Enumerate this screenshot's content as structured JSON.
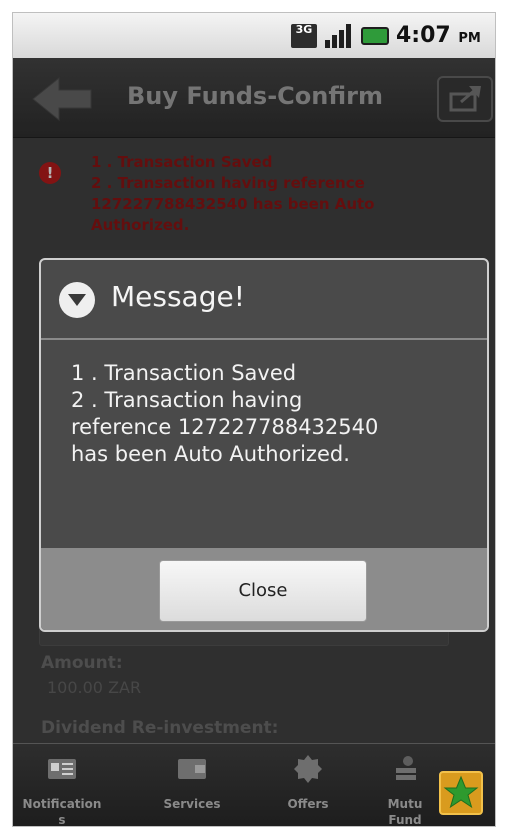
{
  "status_bar": {
    "network_badge": "3G",
    "time": "4:07",
    "ampm": "PM",
    "icons": [
      "3g-icon",
      "signal-icon",
      "battery-icon"
    ]
  },
  "header": {
    "title": "Buy Funds-Confirm",
    "back_icon": "back-arrow-icon",
    "share_icon": "share-icon"
  },
  "background": {
    "error_icon": "!",
    "error_lines": [
      "1 . Transaction Saved",
      "2 . Transaction having reference 127227788432540 has been Auto Authorized."
    ],
    "amount_label": "Amount:",
    "amount_value": "100.00 ZAR",
    "dividend_label": "Dividend Re-investment:"
  },
  "dialog": {
    "title": "Message!",
    "icon": "chevron-down-circle-icon",
    "line1": "1 . Transaction Saved",
    "line2": "2 . Transaction having\nreference 127227788432540\nhas been Auto Authorized.",
    "close_label": "Close"
  },
  "tabs": [
    {
      "label": "Notification\ns",
      "icon": "notification-card-icon"
    },
    {
      "label": "Services",
      "icon": "wallet-icon"
    },
    {
      "label": "Offers",
      "icon": "badge-icon"
    },
    {
      "label": "Mutu\nFund",
      "icon": "coins-icon"
    }
  ],
  "favorite_icon": "star-icon",
  "colors": {
    "error_red": "#7a1212",
    "accent_orange": "#d99b1e",
    "star_green": "#2e9a2e"
  }
}
